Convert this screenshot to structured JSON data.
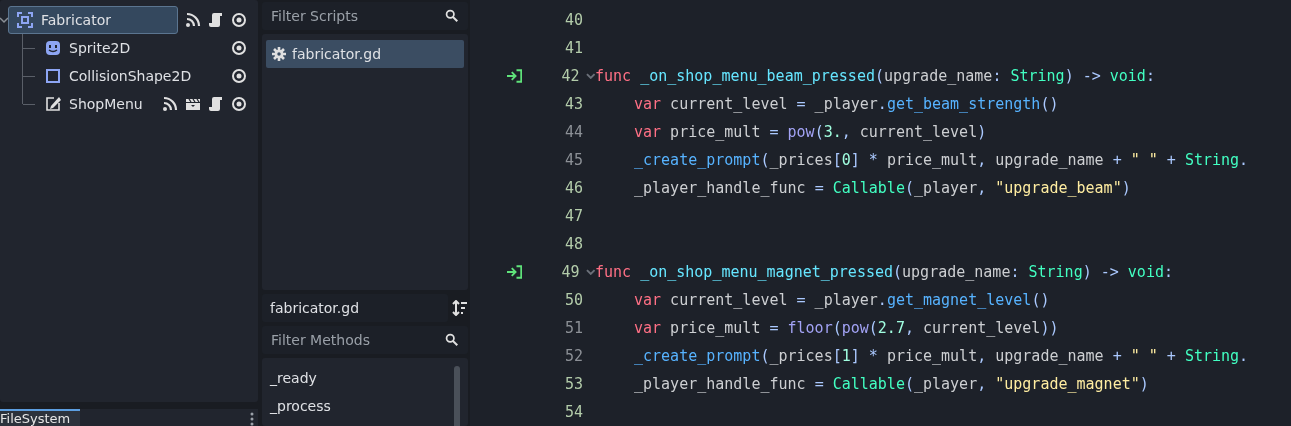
{
  "scene_tree": {
    "nodes": [
      {
        "name": "Fabricator",
        "kind": "node2d",
        "selected": true,
        "expanded": true,
        "badges": [
          {
            "kind": "signals"
          },
          {
            "kind": "script"
          },
          {
            "kind": "visible"
          }
        ],
        "children": [
          {
            "name": "Sprite2D",
            "kind": "sprite",
            "selected": false,
            "badges": [
              {
                "kind": "visible"
              }
            ]
          },
          {
            "name": "CollisionShape2D",
            "kind": "shape",
            "selected": false,
            "badges": [
              {
                "kind": "visible"
              }
            ]
          },
          {
            "name": "ShopMenu",
            "kind": "control",
            "selected": false,
            "badges": [
              {
                "kind": "signals"
              },
              {
                "kind": "scene"
              },
              {
                "kind": "script"
              },
              {
                "kind": "visible"
              }
            ]
          }
        ]
      }
    ]
  },
  "bottom_dock": {
    "tabs": [
      {
        "label": "FileSystem",
        "selected": true
      }
    ]
  },
  "scripts_panel": {
    "filter": {
      "placeholder": "Filter Scripts"
    },
    "scripts": [
      {
        "name": "fabricator.gd",
        "selected": true
      }
    ],
    "current_script": "fabricator.gd",
    "method_filter": {
      "placeholder": "Filter Methods"
    },
    "methods": [
      "_ready",
      "_process"
    ]
  },
  "editor": {
    "lines": [
      {
        "number": "40",
        "safe": true,
        "connected": false,
        "foldable": false
      },
      {
        "number": "41",
        "safe": true,
        "connected": false,
        "foldable": false
      },
      {
        "number": "42",
        "safe": true,
        "connected": true,
        "foldable": true,
        "indented": false,
        "tokens": [
          {
            "kind": "kw",
            "text": "func "
          },
          {
            "kind": "def",
            "text": "_on_shop_menu_beam_pressed"
          },
          {
            "kind": "sym",
            "text": "("
          },
          {
            "kind": "text",
            "text": "upgrade_name"
          },
          {
            "kind": "sym",
            "text": ": "
          },
          {
            "kind": "type",
            "text": "String"
          },
          {
            "kind": "sym",
            "text": ") -> "
          },
          {
            "kind": "type",
            "text": "void"
          },
          {
            "kind": "sym",
            "text": ":"
          }
        ]
      },
      {
        "number": "43",
        "safe": true,
        "connected": false,
        "foldable": false,
        "indented": true,
        "tokens": [
          {
            "kind": "kw",
            "text": "var"
          },
          {
            "kind": "text",
            "text": " current_level "
          },
          {
            "kind": "sym",
            "text": "="
          },
          {
            "kind": "text",
            "text": " _player"
          },
          {
            "kind": "sym",
            "text": "."
          },
          {
            "kind": "call",
            "text": "get_beam_strength"
          },
          {
            "kind": "sym",
            "text": "()"
          }
        ]
      },
      {
        "number": "44",
        "safe": false,
        "connected": false,
        "foldable": false,
        "indented": true,
        "tokens": [
          {
            "kind": "kw",
            "text": "var"
          },
          {
            "kind": "text",
            "text": " price_mult "
          },
          {
            "kind": "sym",
            "text": "= "
          },
          {
            "kind": "global",
            "text": "pow"
          },
          {
            "kind": "sym",
            "text": "("
          },
          {
            "kind": "num",
            "text": "3."
          },
          {
            "kind": "sym",
            "text": ", "
          },
          {
            "kind": "text",
            "text": "current_level"
          },
          {
            "kind": "sym",
            "text": ")"
          }
        ]
      },
      {
        "number": "45",
        "safe": false,
        "connected": false,
        "foldable": false,
        "indented": true,
        "tokens": [
          {
            "kind": "call",
            "text": "_create_prompt"
          },
          {
            "kind": "sym",
            "text": "("
          },
          {
            "kind": "text",
            "text": "_prices"
          },
          {
            "kind": "sym",
            "text": "["
          },
          {
            "kind": "num",
            "text": "0"
          },
          {
            "kind": "sym",
            "text": "] * "
          },
          {
            "kind": "text",
            "text": "price_mult"
          },
          {
            "kind": "sym",
            "text": ", "
          },
          {
            "kind": "text",
            "text": "upgrade_name"
          },
          {
            "kind": "sym",
            "text": " + "
          },
          {
            "kind": "str",
            "text": "\" \""
          },
          {
            "kind": "sym",
            "text": " + "
          },
          {
            "kind": "type",
            "text": "String"
          },
          {
            "kind": "sym",
            "text": "."
          }
        ]
      },
      {
        "number": "46",
        "safe": true,
        "connected": false,
        "foldable": false,
        "indented": true,
        "tokens": [
          {
            "kind": "text",
            "text": "_player_handle_func "
          },
          {
            "kind": "sym",
            "text": "= "
          },
          {
            "kind": "type",
            "text": "Callable"
          },
          {
            "kind": "sym",
            "text": "("
          },
          {
            "kind": "text",
            "text": "_player"
          },
          {
            "kind": "sym",
            "text": ", "
          },
          {
            "kind": "str",
            "text": "\"upgrade_beam\""
          },
          {
            "kind": "sym",
            "text": ")"
          }
        ]
      },
      {
        "number": "47",
        "safe": true,
        "connected": false,
        "foldable": false
      },
      {
        "number": "48",
        "safe": true,
        "connected": false,
        "foldable": false
      },
      {
        "number": "49",
        "safe": true,
        "connected": true,
        "foldable": true,
        "indented": false,
        "tokens": [
          {
            "kind": "kw",
            "text": "func "
          },
          {
            "kind": "def",
            "text": "_on_shop_menu_magnet_pressed"
          },
          {
            "kind": "sym",
            "text": "("
          },
          {
            "kind": "text",
            "text": "upgrade_name"
          },
          {
            "kind": "sym",
            "text": ": "
          },
          {
            "kind": "type",
            "text": "String"
          },
          {
            "kind": "sym",
            "text": ") -> "
          },
          {
            "kind": "type",
            "text": "void"
          },
          {
            "kind": "sym",
            "text": ":"
          }
        ]
      },
      {
        "number": "50",
        "safe": true,
        "connected": false,
        "foldable": false,
        "indented": true,
        "tokens": [
          {
            "kind": "kw",
            "text": "var"
          },
          {
            "kind": "text",
            "text": " current_level "
          },
          {
            "kind": "sym",
            "text": "="
          },
          {
            "kind": "text",
            "text": " _player"
          },
          {
            "kind": "sym",
            "text": "."
          },
          {
            "kind": "call",
            "text": "get_magnet_level"
          },
          {
            "kind": "sym",
            "text": "()"
          }
        ]
      },
      {
        "number": "51",
        "safe": false,
        "connected": false,
        "foldable": false,
        "indented": true,
        "tokens": [
          {
            "kind": "kw",
            "text": "var"
          },
          {
            "kind": "text",
            "text": " price_mult "
          },
          {
            "kind": "sym",
            "text": "= "
          },
          {
            "kind": "global",
            "text": "floor"
          },
          {
            "kind": "sym",
            "text": "("
          },
          {
            "kind": "global",
            "text": "pow"
          },
          {
            "kind": "sym",
            "text": "("
          },
          {
            "kind": "num",
            "text": "2.7"
          },
          {
            "kind": "sym",
            "text": ", "
          },
          {
            "kind": "text",
            "text": "current_level"
          },
          {
            "kind": "sym",
            "text": "))"
          }
        ]
      },
      {
        "number": "52",
        "safe": false,
        "connected": false,
        "foldable": false,
        "indented": true,
        "tokens": [
          {
            "kind": "call",
            "text": "_create_prompt"
          },
          {
            "kind": "sym",
            "text": "("
          },
          {
            "kind": "text",
            "text": "_prices"
          },
          {
            "kind": "sym",
            "text": "["
          },
          {
            "kind": "num",
            "text": "1"
          },
          {
            "kind": "sym",
            "text": "] * "
          },
          {
            "kind": "text",
            "text": "price_mult"
          },
          {
            "kind": "sym",
            "text": ", "
          },
          {
            "kind": "text",
            "text": "upgrade_name"
          },
          {
            "kind": "sym",
            "text": " + "
          },
          {
            "kind": "str",
            "text": "\" \""
          },
          {
            "kind": "sym",
            "text": " + "
          },
          {
            "kind": "type",
            "text": "String"
          },
          {
            "kind": "sym",
            "text": "."
          }
        ]
      },
      {
        "number": "53",
        "safe": true,
        "connected": false,
        "foldable": false,
        "indented": true,
        "tokens": [
          {
            "kind": "text",
            "text": "_player_handle_func "
          },
          {
            "kind": "sym",
            "text": "= "
          },
          {
            "kind": "type",
            "text": "Callable"
          },
          {
            "kind": "sym",
            "text": "("
          },
          {
            "kind": "text",
            "text": "_player"
          },
          {
            "kind": "sym",
            "text": ", "
          },
          {
            "kind": "str",
            "text": "\"upgrade_magnet\""
          },
          {
            "kind": "sym",
            "text": ")"
          }
        ]
      },
      {
        "number": "54",
        "safe": true,
        "connected": false,
        "foldable": false
      }
    ]
  }
}
